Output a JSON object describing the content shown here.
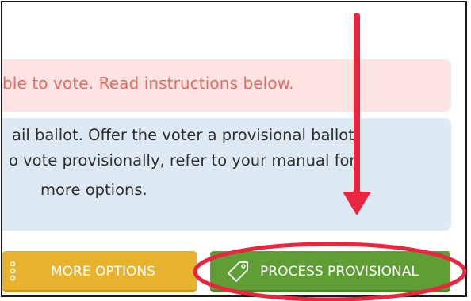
{
  "alert": {
    "text": "ble to vote.  Read instructions below."
  },
  "info": {
    "lines": [
      "ail ballot. Offer the voter a provisional ballot,",
      "o vote provisionally, refer to your manual for",
      "more options."
    ]
  },
  "buttons": {
    "more_options": "MORE OPTIONS",
    "process_provisional": "PROCESS PROVISIONAL"
  },
  "icons": {
    "more_options": "options-icon",
    "process_provisional": "tag-icon"
  },
  "colors": {
    "alert_bg": "#fde4e3",
    "alert_text": "#e26a63",
    "info_bg": "#dde9f3",
    "more_options_bg": "#e7b32e",
    "process_bg": "#5f9e35",
    "annotation": "#e8263f"
  }
}
